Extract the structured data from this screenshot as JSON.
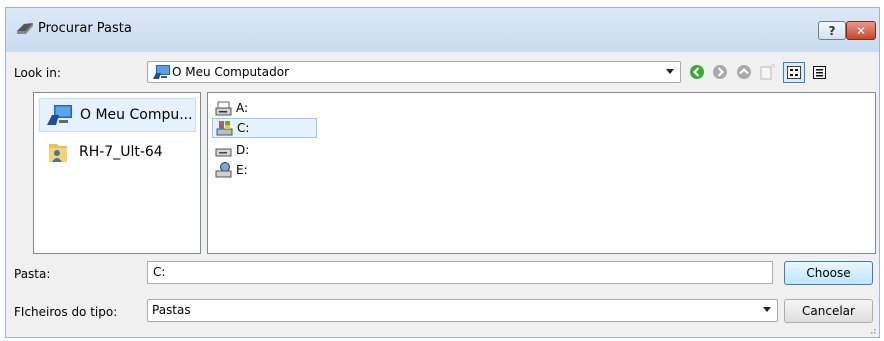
{
  "window": {
    "title": "Procurar Pasta",
    "help_label": "?",
    "close_label": "✕"
  },
  "lookin": {
    "label": "Look in:",
    "value": "O Meu Computador"
  },
  "toolbar": {
    "icons": [
      "back-icon",
      "forward-icon",
      "up-icon",
      "new-folder-icon",
      "list-view-icon",
      "details-view-icon"
    ]
  },
  "places": [
    {
      "label": "O Meu Compu...",
      "icon": "computer-icon",
      "selected": true
    },
    {
      "label": "RH-7_Ult-64",
      "icon": "user-folder-icon",
      "selected": false
    }
  ],
  "drives": [
    {
      "label": "A:",
      "icon": "floppy-drive-icon",
      "selected": false
    },
    {
      "label": "C:",
      "icon": "system-drive-icon",
      "selected": true
    },
    {
      "label": "D:",
      "icon": "cd-drive-icon",
      "selected": false
    },
    {
      "label": "E:",
      "icon": "network-drive-icon",
      "selected": false
    }
  ],
  "folder_field": {
    "label": "Pasta:",
    "value": "C:"
  },
  "filetype": {
    "label": "FIcheiros do tipo:",
    "value": "Pastas"
  },
  "buttons": {
    "choose": "Choose",
    "cancel": "Cancelar"
  },
  "colors": {
    "accent": "#3c7fb1",
    "selection": "#e5f1fb",
    "nav_green": "#3aa93a",
    "close_red": "#c9462c"
  }
}
